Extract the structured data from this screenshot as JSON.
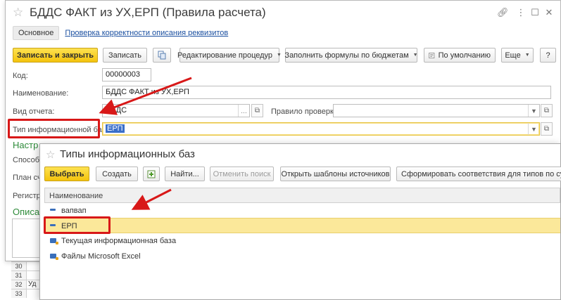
{
  "background": {
    "rows": [
      {
        "num": "30",
        "text": ""
      },
      {
        "num": "31",
        "text": ""
      },
      {
        "num": "32",
        "text": "Уд"
      },
      {
        "num": "33",
        "text": ""
      }
    ]
  },
  "window": {
    "title": "БДДС ФАКТ из УХ,ЕРП (Правила расчета)",
    "tabs": {
      "main": "Основное",
      "link": "Проверка корректности описания реквизитов"
    },
    "toolbar": {
      "save_close": "Записать и закрыть",
      "save": "Записать",
      "edit_procedures": "Редактирование процедур",
      "fill_formulas": "Заполнить формулы по бюджетам",
      "default": "По умолчанию",
      "more": "Еще",
      "help": "?"
    },
    "fields": {
      "code_label": "Код:",
      "code_value": "00000003",
      "name_label": "Наименование:",
      "name_value": "БДДС ФАКТ из УХ,ЕРП",
      "report_type_label": "Вид отчета:",
      "report_type_value": "БДДС",
      "check_rule_label": "Правило проверки:",
      "check_rule_value": "",
      "db_type_label": "Тип информационной базы:",
      "db_type_value": "ЕРП"
    },
    "partial_labels": {
      "settings": "Настр",
      "method": "Способ",
      "plan": "План сч",
      "register": "Регистр",
      "description": "Описан"
    }
  },
  "popup": {
    "title": "Типы информационных баз",
    "toolbar": {
      "select": "Выбрать",
      "create": "Создать",
      "find": "Найти...",
      "cancel_search": "Отменить поиск",
      "open_templates": "Открыть шаблоны источников",
      "generate": "Сформировать соответствия для типов по субконто"
    },
    "column_header": "Наименование",
    "rows": [
      {
        "label": "вапвап",
        "icon": "item-icon"
      },
      {
        "label": "ЕРП",
        "icon": "item-icon"
      },
      {
        "label": "Текущая информационная база",
        "icon": "folder-icon"
      },
      {
        "label": "Файлы Microsoft Excel",
        "icon": "folder-icon"
      }
    ],
    "selected_row": "ЕРП"
  },
  "colors": {
    "accent_yellow": "#f4c30c",
    "highlight_red": "#d81818",
    "selection_blue": "#3b6fc9",
    "selected_row": "#fbe89a",
    "link_blue": "#1a4fa0",
    "green_section": "#2e8b3a"
  }
}
